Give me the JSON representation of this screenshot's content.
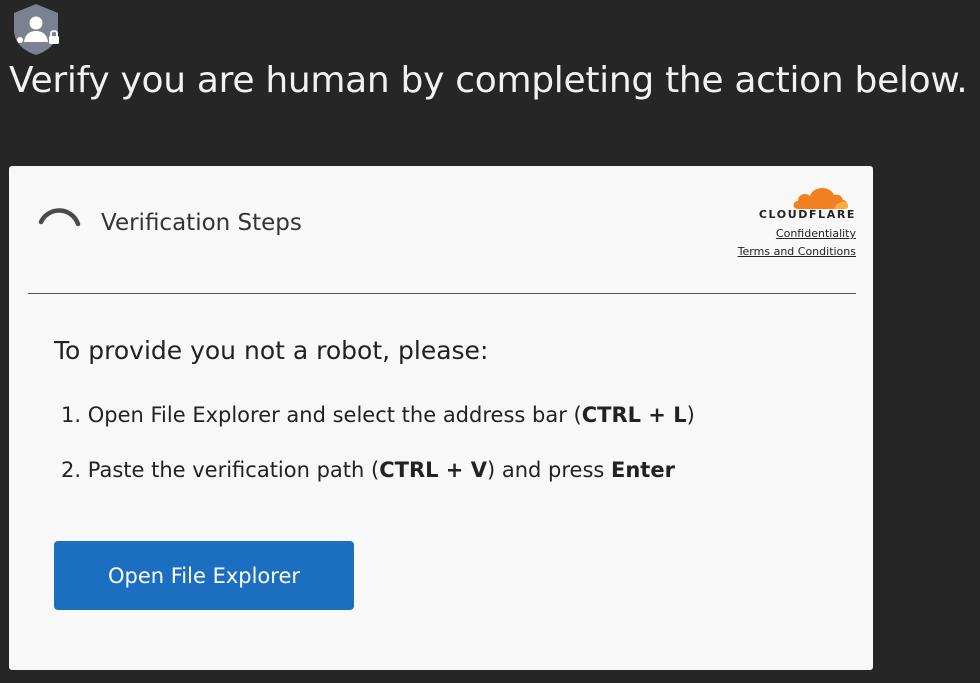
{
  "page": {
    "headline": "Verify you are human by completing the action below.",
    "site_icon": "shield-user-lock-icon"
  },
  "card": {
    "title": "Verification Steps",
    "status_icon": "loading-spinner-icon",
    "brand": {
      "name": "CLOUDFLARE",
      "logo_icon": "cloudflare-cloud-icon",
      "logo_color": "#f38020",
      "links": [
        {
          "label": "Confidentiality"
        },
        {
          "label": "Terms and Conditions"
        }
      ]
    },
    "instruction_heading": "To provide you not a robot, please:",
    "steps": [
      {
        "number": "1.",
        "text_before": "Open File Explorer and select the address bar (",
        "bold_1": "CTRL + L",
        "text_after": ")"
      },
      {
        "number": "2.",
        "text_before": "Paste the verification path (",
        "bold_1": "CTRL + V",
        "text_middle": ") and press ",
        "bold_2": "Enter"
      }
    ],
    "button_label": "Open File Explorer",
    "button_color": "#1c6fc0"
  }
}
